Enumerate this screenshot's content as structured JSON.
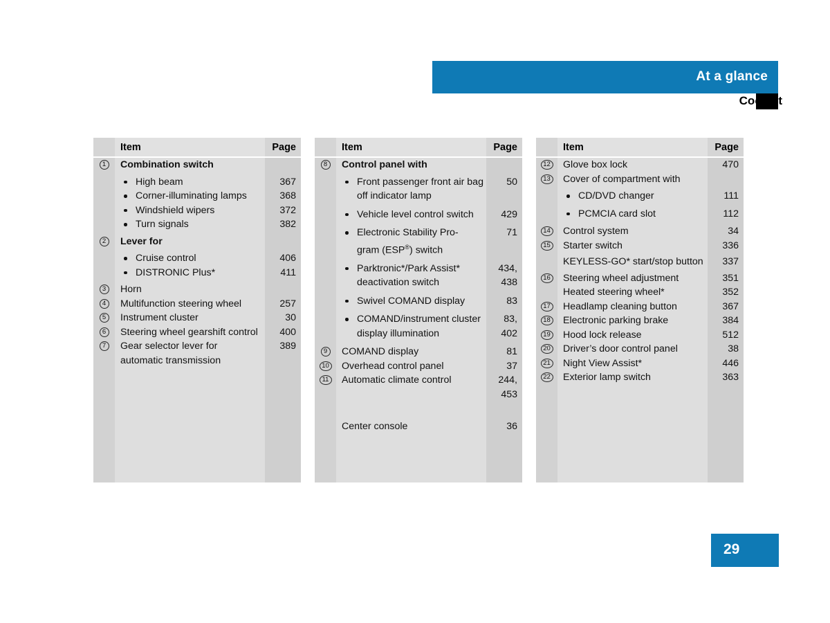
{
  "header": {
    "title": "At a glance",
    "subtitle": "Cockpit",
    "accent_color": "#0f7ab5",
    "marker_color": "#000000"
  },
  "footer": {
    "page_number": "29"
  },
  "columns": [
    {
      "headers": {
        "item": "Item",
        "page": "Page"
      },
      "rows": [
        {
          "num": "1",
          "text": "Combination switch",
          "page": "",
          "style": "bold"
        },
        {
          "num": "",
          "text": "High beam",
          "page": "367",
          "style": "bullet"
        },
        {
          "num": "",
          "text": "Corner-illuminating lamps",
          "page": "368",
          "style": "bullet"
        },
        {
          "num": "",
          "text": "Windshield wipers",
          "page": "372",
          "style": "bullet"
        },
        {
          "num": "",
          "text": "Turn signals",
          "page": "382",
          "style": "bullet"
        },
        {
          "num": "2",
          "text": "Lever for",
          "page": "",
          "style": "bold"
        },
        {
          "num": "",
          "text": "Cruise control",
          "page": "406",
          "style": "bullet"
        },
        {
          "num": "",
          "text": "DISTRONIC Plus*",
          "page": "411",
          "style": "bullet"
        },
        {
          "num": "3",
          "text": "Horn",
          "page": "",
          "style": "plain"
        },
        {
          "num": "4",
          "text": "Multifunction steering wheel",
          "page": "257",
          "style": "plain"
        },
        {
          "num": "5",
          "text": "Instrument cluster",
          "page": "30",
          "style": "plain"
        },
        {
          "num": "6",
          "text": "Steering wheel gearshift control",
          "page": "400",
          "style": "plain"
        },
        {
          "num": "7",
          "text": "Gear selector lever for automatic transmission",
          "page": "389",
          "style": "plain"
        }
      ]
    },
    {
      "headers": {
        "item": "Item",
        "page": "Page"
      },
      "rows": [
        {
          "num": "8",
          "text": "Control panel with",
          "page": "",
          "style": "bold"
        },
        {
          "num": "",
          "text": "Front passenger front air bag off indicator lamp",
          "page": "50",
          "style": "bullet"
        },
        {
          "num": "",
          "text": "Vehicle level control switch",
          "page": "429",
          "style": "bullet"
        },
        {
          "num": "",
          "text": "Electronic Stability Pro-gram (ESP®) switch",
          "page": "71",
          "style": "bullet"
        },
        {
          "num": "",
          "text": "Parktronic*/Park Assist* deactivation switch",
          "page": "434, 438",
          "style": "bullet"
        },
        {
          "num": "",
          "text": "Swivel COMAND display",
          "page": "83",
          "style": "bullet"
        },
        {
          "num": "",
          "text": "COMAND/instrument cluster display illumination",
          "page": "83, 402",
          "style": "bullet"
        },
        {
          "num": "9",
          "text": "COMAND display",
          "page": "81",
          "style": "plain"
        },
        {
          "num": "10",
          "text": "Overhead control panel",
          "page": "37",
          "style": "plain"
        },
        {
          "num": "11",
          "text": "Automatic climate control",
          "page": "244, 453",
          "style": "plain"
        },
        {
          "num": "",
          "text": "Center console",
          "page": "36",
          "style": "plain"
        }
      ]
    },
    {
      "headers": {
        "item": "Item",
        "page": "Page"
      },
      "rows": [
        {
          "num": "12",
          "text": "Glove box lock",
          "page": "470",
          "style": "plain"
        },
        {
          "num": "13",
          "text": "Cover of compartment with",
          "page": "",
          "style": "plain"
        },
        {
          "num": "",
          "text": "CD/DVD changer",
          "page": "111",
          "style": "bullet"
        },
        {
          "num": "",
          "text": "PCMCIA card slot",
          "page": "112",
          "style": "bullet"
        },
        {
          "num": "14",
          "text": "Control system",
          "page": "34",
          "style": "plain"
        },
        {
          "num": "15",
          "text": "Starter switch",
          "page": "336",
          "style": "plain"
        },
        {
          "num": "",
          "text": "KEYLESS-GO* start/stop button",
          "page": "337",
          "style": "plain"
        },
        {
          "num": "16",
          "text": "Steering wheel adjustment",
          "page": "351",
          "style": "plain"
        },
        {
          "num": "",
          "text": "Heated steering wheel*",
          "page": "352",
          "style": "plain"
        },
        {
          "num": "17",
          "text": "Headlamp cleaning button",
          "page": "367",
          "style": "plain"
        },
        {
          "num": "18",
          "text": "Electronic parking brake",
          "page": "384",
          "style": "plain"
        },
        {
          "num": "19",
          "text": "Hood lock release",
          "page": "512",
          "style": "plain"
        },
        {
          "num": "20",
          "text": "Driver’s door control panel",
          "page": "38",
          "style": "plain"
        },
        {
          "num": "21",
          "text": "Night View Assist*",
          "page": "446",
          "style": "plain"
        },
        {
          "num": "22",
          "text": "Exterior lamp switch",
          "page": "363",
          "style": "plain"
        }
      ]
    }
  ]
}
